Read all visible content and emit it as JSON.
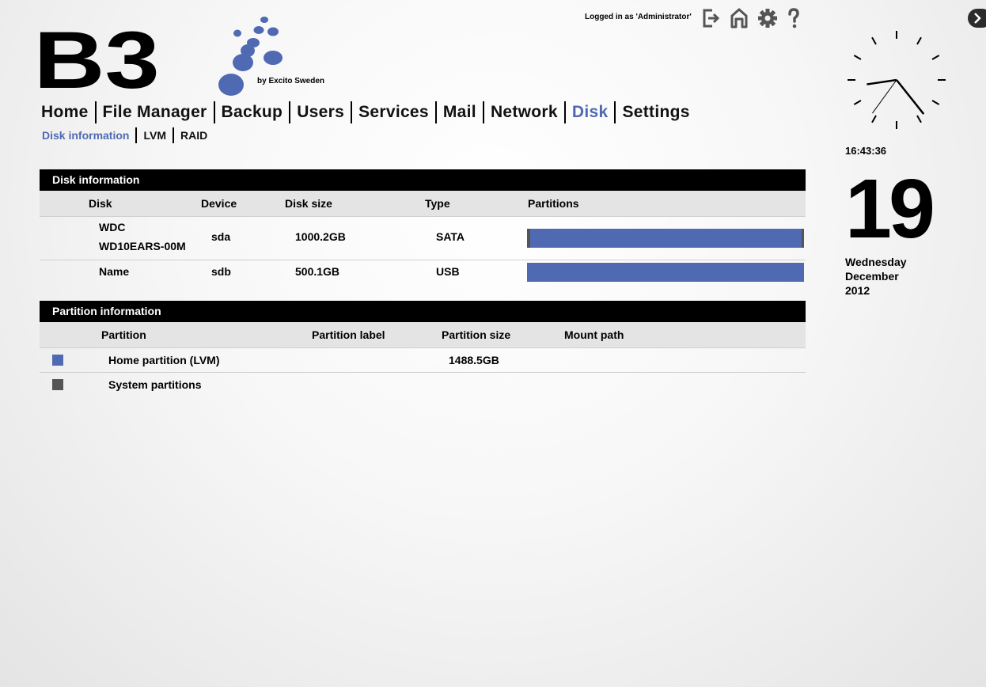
{
  "header": {
    "login_text": "Logged in as 'Administrator'",
    "icons": [
      "logout-icon",
      "home-icon",
      "gear-icon",
      "help-icon"
    ],
    "side_toggle_icon": "chevron-right-icon"
  },
  "logo": {
    "mark": "B3",
    "byline": "by Excito Sweden",
    "dot_color": "#4f6ab3"
  },
  "nav": {
    "items": [
      "Home",
      "File Manager",
      "Backup",
      "Users",
      "Services",
      "Mail",
      "Network",
      "Disk",
      "Settings"
    ],
    "active": "Disk"
  },
  "subnav": {
    "items": [
      "Disk information",
      "LVM",
      "RAID"
    ],
    "active": "Disk information"
  },
  "disk_info": {
    "title": "Disk information",
    "columns": [
      "Disk",
      "Device",
      "Disk size",
      "Type",
      "Partitions"
    ],
    "rows": [
      {
        "disk_line1": "WDC",
        "disk_line2": "WD10EARS-00M",
        "device": "sda",
        "size": "1000.2GB",
        "type": "SATA",
        "lvm_fraction": 0.98
      },
      {
        "disk_line1": "Name",
        "disk_line2": "",
        "device": "sdb",
        "size": "500.1GB",
        "type": "USB",
        "lvm_fraction": 1.0
      }
    ]
  },
  "partition_info": {
    "title": "Partition information",
    "columns": [
      "Partition",
      "Partition label",
      "Partition size",
      "Mount path"
    ],
    "rows": [
      {
        "name": "Home partition (LVM)",
        "label": "",
        "size": "1488.5GB",
        "mount": "",
        "color": "#4f6ab3"
      },
      {
        "name": "System partitions",
        "label": "",
        "size": "",
        "mount": "",
        "color": "#555555"
      }
    ]
  },
  "clock": {
    "time": "16:43:36",
    "day": "19",
    "weekday": "Wednesday",
    "month": "December",
    "year": "2012"
  },
  "colors": {
    "accent": "#4f6ab3",
    "system": "#555555"
  }
}
